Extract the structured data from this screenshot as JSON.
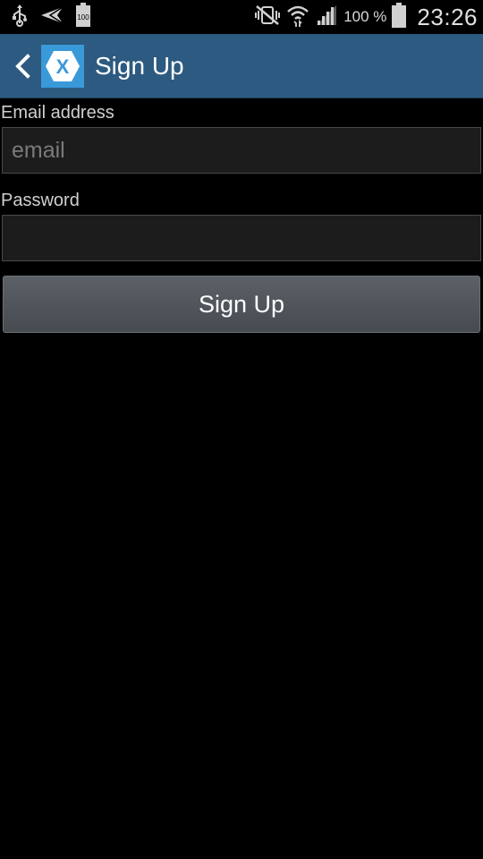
{
  "status_bar": {
    "icons": [
      "usb-icon",
      "send-icon",
      "battery-storage-icon",
      "mute-vibrate-icon",
      "wifi-icon",
      "signal-icon",
      "battery-icon"
    ],
    "storage_badge": "100",
    "battery_percent": "100 %",
    "time": "23:26"
  },
  "action_bar": {
    "back_icon": "chevron-left-icon",
    "logo_icon": "xamarin-logo-icon",
    "logo_letter": "X",
    "title": "Sign Up",
    "background": "#2d5a80"
  },
  "form": {
    "email_label": "Email address",
    "email_placeholder": "email",
    "email_value": "",
    "password_label": "Password",
    "password_value": "",
    "submit_label": "Sign Up"
  }
}
